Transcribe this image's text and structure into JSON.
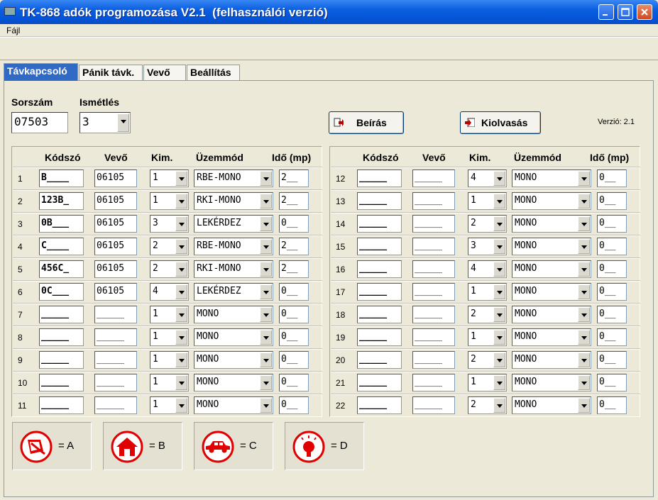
{
  "window": {
    "title": "TK-868 adók programozása V2.1  (felhasználói verzió)",
    "app_icon": "app-icon"
  },
  "menu": {
    "file": "Fájl"
  },
  "tabs": [
    {
      "label": "Távkapcsoló",
      "active": true
    },
    {
      "label": "Pánik távk."
    },
    {
      "label": "Vevő"
    },
    {
      "label": "Beállítás"
    }
  ],
  "form": {
    "serial_label": "Sorszám",
    "serial_value": "07503",
    "repeat_label": "Ismétlés",
    "repeat_value": "3",
    "write_button": "Beírás",
    "read_button": "Kiolvasás",
    "version": "Verzió: 2.1"
  },
  "table_headers": [
    "Kódszó",
    "Vevő",
    "Kim.",
    "Üzemmód",
    "Idő (mp)"
  ],
  "rows": [
    {
      "n": "1",
      "kod": "B____",
      "vevo": "06105",
      "kim": "1",
      "mode": "RBE-MONO",
      "ido": "2__"
    },
    {
      "n": "2",
      "kod": "123B_",
      "vevo": "06105",
      "kim": "1",
      "mode": "RKI-MONO",
      "ido": "2__"
    },
    {
      "n": "3",
      "kod": "0B___",
      "vevo": "06105",
      "kim": "3",
      "mode": "LEKÉRDEZ",
      "ido": "0__"
    },
    {
      "n": "4",
      "kod": "C____",
      "vevo": "06105",
      "kim": "2",
      "mode": "RBE-MONO",
      "ido": "2__"
    },
    {
      "n": "5",
      "kod": "456C_",
      "vevo": "06105",
      "kim": "2",
      "mode": "RKI-MONO",
      "ido": "2__"
    },
    {
      "n": "6",
      "kod": "0C___",
      "vevo": "06105",
      "kim": "4",
      "mode": "LEKÉRDEZ",
      "ido": "0__"
    },
    {
      "n": "7",
      "kod": "_____",
      "vevo": "_____",
      "kim": "1",
      "mode": "MONO",
      "ido": "0__"
    },
    {
      "n": "8",
      "kod": "_____",
      "vevo": "_____",
      "kim": "1",
      "mode": "MONO",
      "ido": "0__"
    },
    {
      "n": "9",
      "kod": "_____",
      "vevo": "_____",
      "kim": "1",
      "mode": "MONO",
      "ido": "0__"
    },
    {
      "n": "10",
      "kod": "_____",
      "vevo": "_____",
      "kim": "1",
      "mode": "MONO",
      "ido": "0__"
    },
    {
      "n": "11",
      "kod": "_____",
      "vevo": "_____",
      "kim": "1",
      "mode": "MONO",
      "ido": "0__"
    },
    {
      "n": "12",
      "kod": "_____",
      "vevo": "_____",
      "kim": "4",
      "mode": "MONO",
      "ido": "0__"
    },
    {
      "n": "13",
      "kod": "_____",
      "vevo": "_____",
      "kim": "1",
      "mode": "MONO",
      "ido": "0__"
    },
    {
      "n": "14",
      "kod": "_____",
      "vevo": "_____",
      "kim": "2",
      "mode": "MONO",
      "ido": "0__"
    },
    {
      "n": "15",
      "kod": "_____",
      "vevo": "_____",
      "kim": "3",
      "mode": "MONO",
      "ido": "0__"
    },
    {
      "n": "16",
      "kod": "_____",
      "vevo": "_____",
      "kim": "4",
      "mode": "MONO",
      "ido": "0__"
    },
    {
      "n": "17",
      "kod": "_____",
      "vevo": "_____",
      "kim": "1",
      "mode": "MONO",
      "ido": "0__"
    },
    {
      "n": "18",
      "kod": "_____",
      "vevo": "_____",
      "kim": "2",
      "mode": "MONO",
      "ido": "0__"
    },
    {
      "n": "19",
      "kod": "_____",
      "vevo": "_____",
      "kim": "1",
      "mode": "MONO",
      "ido": "0__"
    },
    {
      "n": "20",
      "kod": "_____",
      "vevo": "_____",
      "kim": "2",
      "mode": "MONO",
      "ido": "0__"
    },
    {
      "n": "21",
      "kod": "_____",
      "vevo": "_____",
      "kim": "1",
      "mode": "MONO",
      "ido": "0__"
    },
    {
      "n": "22",
      "kod": "_____",
      "vevo": "_____",
      "kim": "2",
      "mode": "MONO",
      "ido": "0__"
    }
  ],
  "legend": [
    {
      "icon": "window-sensor-icon",
      "label": "= A"
    },
    {
      "icon": "house-icon",
      "label": "= B"
    },
    {
      "icon": "car-icon",
      "label": "= C"
    },
    {
      "icon": "light-bulb-icon",
      "label": "= D"
    }
  ],
  "colors": {
    "title_bar": "#0a5fe0",
    "active_tab": "#316ac5",
    "legend_icon": "#e00000",
    "window_bg": "#ece9d8"
  }
}
